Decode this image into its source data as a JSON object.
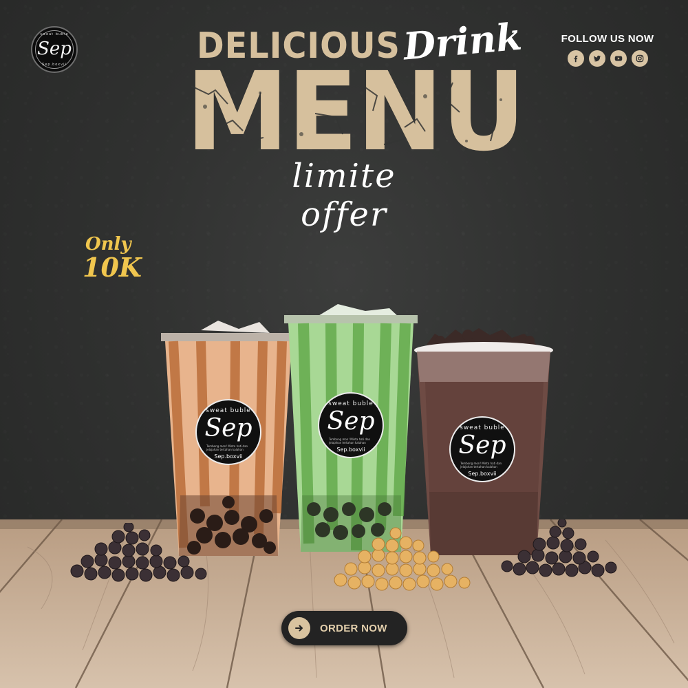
{
  "brand": {
    "logo_signature": "Sep",
    "logo_top_text": "sweat buble",
    "logo_bottom_text": "Sep.boxvii"
  },
  "social": {
    "label": "FOLLOW US NOW",
    "icons": [
      "facebook-icon",
      "twitter-icon",
      "youtube-icon",
      "instagram-icon"
    ]
  },
  "headline": {
    "line1": "DELICIOUS",
    "line1_script": "Drink",
    "line2": "MENU",
    "line3": "limite offer"
  },
  "price": {
    "prefix": "Only",
    "amount": "10K"
  },
  "cups": [
    {
      "flavor": "brown-sugar",
      "badge_top": "sweat buble",
      "badge_sig": "Sep",
      "badge_small": "Tembong mon! Minta hati dan jelajahan tertahan kalahan",
      "badge_bottom": "Sep.boxvii"
    },
    {
      "flavor": "matcha",
      "badge_top": "sweat buble",
      "badge_sig": "Sep",
      "badge_small": "Tembong mon! Minta hati dan jelajahan tertahan kalahan",
      "badge_bottom": "Sep.boxvii"
    },
    {
      "flavor": "chocolate",
      "badge_top": "sweat buble",
      "badge_sig": "Sep",
      "badge_small": "Tembong mon! Minta hati dan jelajahan tertahan kalahan",
      "badge_bottom": "Sep.boxvii"
    }
  ],
  "cta": {
    "label": "ORDER NOW",
    "icon": "arrow-right-icon"
  },
  "colors": {
    "background": "#2f302f",
    "headline_tan": "#d6c09d",
    "price_gold": "#f0c64e",
    "button_dark": "#232323"
  }
}
